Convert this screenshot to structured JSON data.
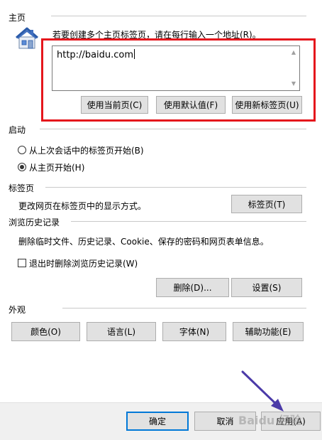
{
  "home": {
    "section_label": "主页",
    "instruction": "若要创建多个主页标签页，请在每行输入一个地址(R)。",
    "url_value": "http://baidu.com",
    "buttons": {
      "use_current": "使用当前页(C)",
      "use_default": "使用默认值(F)",
      "use_new_tab": "使用新标签页(U)"
    }
  },
  "startup": {
    "section_label": "启动",
    "option_last_session": "从上次会话中的标签页开始(B)",
    "option_home": "从主页开始(H)",
    "selected": "option_home"
  },
  "tabs": {
    "section_label": "标签页",
    "description": "更改网页在标签页中的显示方式。",
    "button": "标签页(T)"
  },
  "history": {
    "section_label": "浏览历史记录",
    "description": "删除临时文件、历史记录、Cookie、保存的密码和网页表单信息。",
    "checkbox_label": "退出时删除浏览历史记录(W)",
    "checkbox_checked": false,
    "delete_button": "删除(D)...",
    "settings_button": "设置(S)"
  },
  "appearance": {
    "section_label": "外观",
    "buttons": {
      "colors": "颜色(O)",
      "languages": "语言(L)",
      "fonts": "字体(N)",
      "accessibility": "辅助功能(E)"
    }
  },
  "footer": {
    "ok": "确定",
    "cancel": "取消",
    "apply": "应用(A)"
  },
  "watermark": {
    "text": "Baidu 经验"
  },
  "colors": {
    "highlight_box": "#e5161c",
    "annotation_arrow": "#4b3aa8",
    "default_button_border": "#0078d7"
  }
}
